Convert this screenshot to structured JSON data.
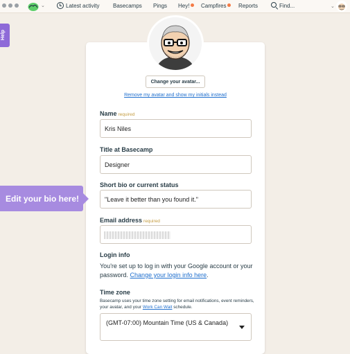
{
  "nav": {
    "latest_activity": "Latest activity",
    "basecamps": "Basecamps",
    "pings": "Pings",
    "hey": "Hey!",
    "campfires": "Campfires",
    "reports": "Reports",
    "find": "Find...",
    "accent": "#f47a45"
  },
  "help_tab": "Help",
  "callout": "Edit your bio here!",
  "profile": {
    "change_avatar": "Change your avatar...",
    "remove_avatar": "Remove my avatar and show my initials instead",
    "name_label": "Name",
    "name_required": "required",
    "name_value": "Kris Niles",
    "title_label": "Title at Basecamp",
    "title_value": "Designer",
    "bio_label": "Short bio or current status",
    "bio_value": "\"Leave it better than you found it.\"",
    "email_label": "Email address",
    "email_required": "required",
    "login_label": "Login info",
    "login_text": "You're set up to log in with your Google account or your password.",
    "login_link": "Change your login info here",
    "timezone_label": "Time zone",
    "timezone_help_1": "Basecamp uses your time zone setting for email notifications, event reminders, your avatar, and your",
    "timezone_help_link": "Work Can Wait",
    "timezone_help_2": "schedule.",
    "timezone_value": "(GMT-07:00) Mountain Time (US & Canada)"
  }
}
